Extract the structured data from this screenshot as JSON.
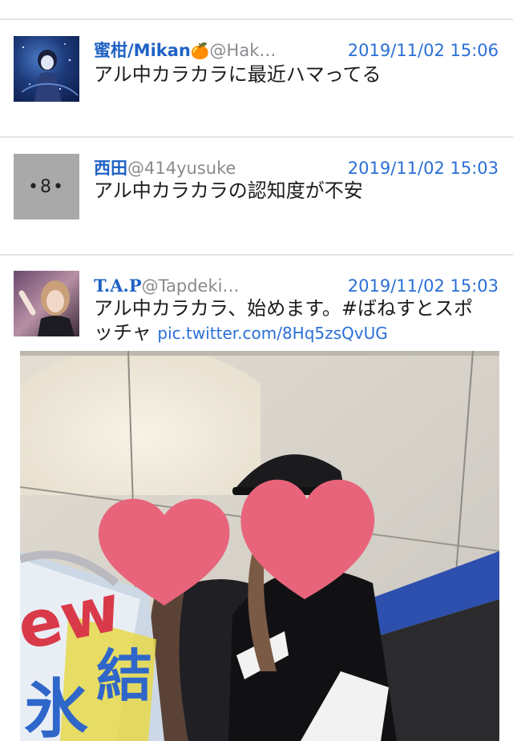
{
  "tweets": [
    {
      "name": "蜜柑/Mikan",
      "name_emoji": "🍊",
      "handle": "@Hak…",
      "time": "2019/11/02 15:06",
      "text": "アル中カラカラに最近ハマってる"
    },
    {
      "name": "西田",
      "handle": "@414yusuke",
      "time": "2019/11/02 15:03",
      "text": "アル中カラカラの認知度が不安",
      "avatar_glyph": "•8•"
    },
    {
      "name": "T.A.P",
      "handle": "@Tapdeki…",
      "time": "2019/11/02 15:03",
      "text_line1": "アル中カラカラ、始めます。#ばねすとスポ",
      "text_line2": "ッチャ",
      "link": "pic.twitter.com/8Hq5zsQvUG"
    }
  ],
  "photo": {
    "can_text_1": "ew",
    "can_text_2": "氷",
    "can_text_3": "結"
  },
  "colors": {
    "link_blue": "#2a6fd6",
    "name_blue": "#1f62c4",
    "separator": "#e3e3e6",
    "heart": "#e8647a"
  }
}
